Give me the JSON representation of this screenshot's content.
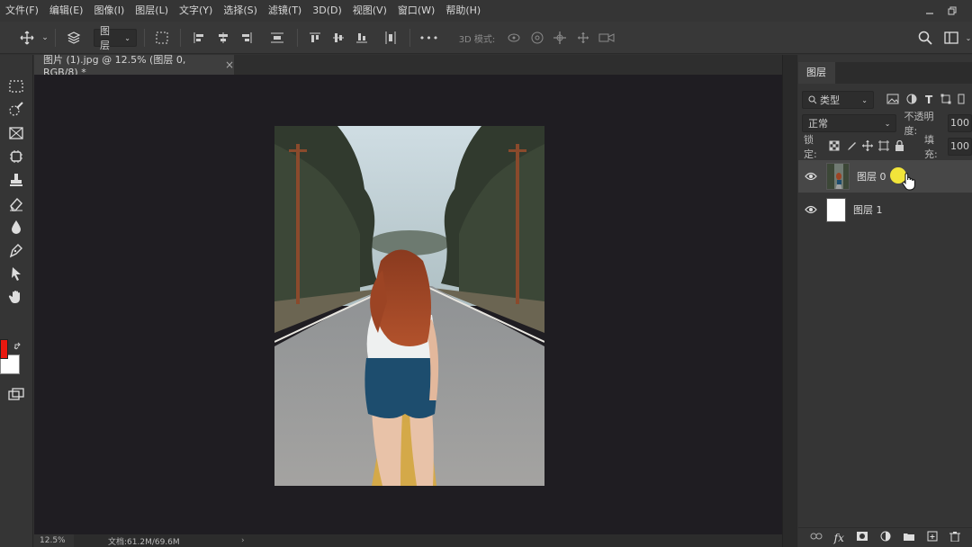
{
  "menubar": {
    "items": [
      "文件(F)",
      "编辑(E)",
      "图像(I)",
      "图层(L)",
      "文字(Y)",
      "选择(S)",
      "滤镜(T)",
      "3D(D)",
      "视图(V)",
      "窗口(W)",
      "帮助(H)"
    ]
  },
  "options": {
    "auto_select_target": "图层",
    "mode_3d_label": "3D 模式:",
    "more_label": "•••"
  },
  "document": {
    "tab_title": "图片 (1).jpg @ 12.5% (图层 0, RGB/8) *",
    "tab_close": "×",
    "zoom": "12.5%",
    "doc_size": "文档:61.2M/69.6M",
    "status_arrow": "›"
  },
  "colors": {
    "foreground": "#e8180f",
    "background": "#ffffff",
    "cursor_highlight": "#f2e53a"
  },
  "layers_panel": {
    "tab_label": "图层",
    "filter_kind": "类型",
    "blend_mode": "正常",
    "opacity_label": "不透明度:",
    "opacity_value": "100",
    "lock_label": "锁定:",
    "fill_label": "填充:",
    "fill_value": "100",
    "layers": [
      {
        "name": "图层 0",
        "visible": true,
        "selected": true,
        "thumb": "photo"
      },
      {
        "name": "图层 1",
        "visible": true,
        "selected": false,
        "thumb": "white"
      }
    ],
    "bottom_icons": [
      "link-icon",
      "fx-icon",
      "mask-icon",
      "adjustment-icon",
      "folder-icon",
      "new-layer-icon",
      "trash-icon"
    ],
    "fx_label": "fx"
  }
}
